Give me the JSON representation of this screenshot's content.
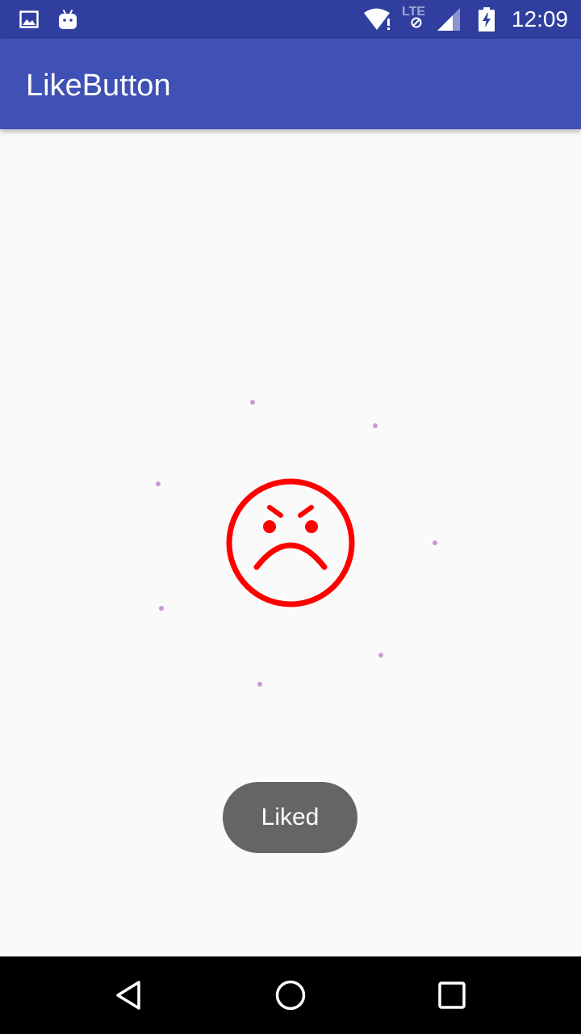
{
  "status_bar": {
    "time": "12:09",
    "network_label": "LTE",
    "icons": [
      "image-icon",
      "android-icon",
      "wifi-icon",
      "no-data-icon",
      "signal-icon",
      "battery-charging-icon"
    ]
  },
  "app_bar": {
    "title": "LikeButton"
  },
  "main": {
    "like_button_icon": "angry-face-icon",
    "like_button_color": "#ff0000",
    "sparkle_color": "#c79bd1"
  },
  "toast": {
    "message": "Liked"
  },
  "nav_bar": {
    "back_icon": "back-icon",
    "home_icon": "home-icon",
    "recents_icon": "recents-icon"
  }
}
